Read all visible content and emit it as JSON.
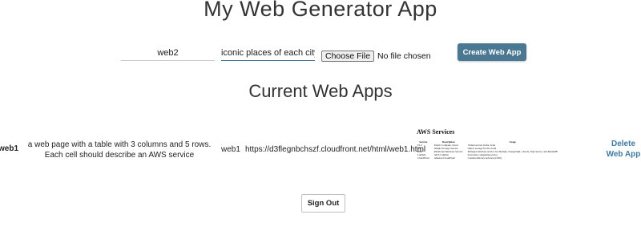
{
  "page": {
    "title": "My Web Generator App"
  },
  "form": {
    "name_value": "web2",
    "description_value": "iconic places of each city",
    "file_button_label": "Choose File",
    "file_status": "No file chosen",
    "create_button_label": "Create Web App"
  },
  "apps_section": {
    "title": "Current Web Apps",
    "rows": [
      {
        "name": "web1",
        "description": "a web page with a table with 3 columns and 5 rows. Each cell should describe an AWS service",
        "id": "web1",
        "url": "https://d3flegnbchszf.cloudfront.net/html/web1.html",
        "preview": {
          "title": "AWS Services",
          "headers": [
            "Service",
            "Description",
            "Usage"
          ],
          "rows": [
            [
              "EC2",
              "Elastic Compute Cloud",
              "Virtual servers in the cloud"
            ],
            [
              "S3",
              "Simple Storage Service",
              "Object storage for the cloud"
            ],
            [
              "RDS",
              "Relational Database Service",
              "Managed database service for MySQL, PostgreSQL, Oracle, SQL Server, and MariaDB"
            ],
            [
              "Lambda",
              "AWS Lambda",
              "Serverless computing service"
            ],
            [
              "CloudFront",
              "Amazon CloudFront",
              "Content delivery network (CDN)"
            ]
          ]
        },
        "delete_label_line1": "Delete",
        "delete_label_line2": "Web App"
      }
    ]
  },
  "signout_label": "Sign Out",
  "colors": {
    "primary_button": "#4a7792",
    "link": "#3f7aa2"
  }
}
